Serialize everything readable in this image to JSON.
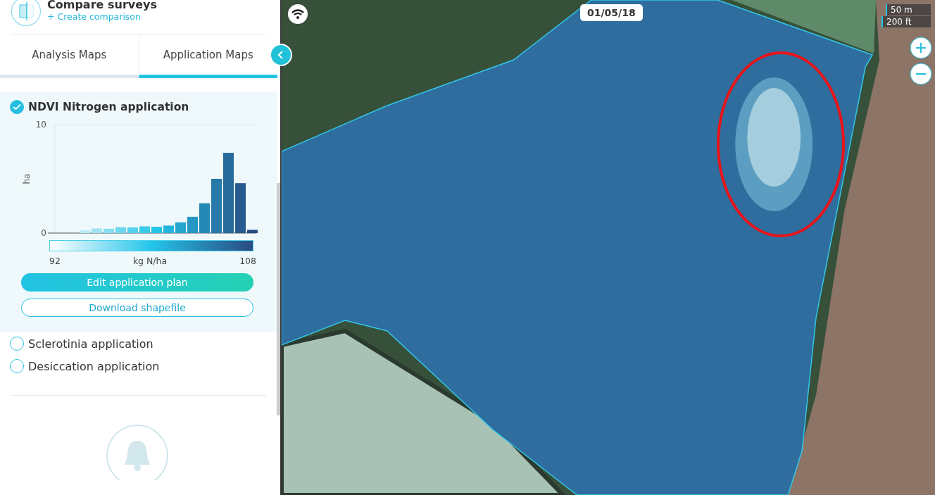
{
  "header": {
    "title": "Compare surveys",
    "link": "+ Create comparison"
  },
  "tabs": [
    {
      "label": "Analysis Maps",
      "selected": false
    },
    {
      "label": "Application Maps",
      "selected": true
    }
  ],
  "layers": [
    {
      "name": "NDVI Nitrogen application",
      "checked": true,
      "details": {
        "chart_data": {
          "type": "bar",
          "ylabel": "ha",
          "yticks": [
            0,
            10
          ],
          "ylim": [
            0,
            10
          ],
          "series": [
            {
              "values": [
                0,
                0,
                0.26,
                0.43,
                0.4,
                0.54,
                0.52,
                0.62,
                0.58,
                0.69,
                0.99,
                1.5,
                2.75,
                5.0,
                7.4,
                4.6,
                0.3
              ]
            }
          ]
        },
        "scale_min": "92",
        "scale_unit": "kg N/ha",
        "scale_max": "108",
        "primary_button": "Edit application plan",
        "secondary_button": "Download shapefile"
      }
    },
    {
      "name": "Sclerotinia application",
      "checked": false
    },
    {
      "name": "Desiccation application",
      "checked": false
    }
  ],
  "map": {
    "date": "01/05/18",
    "scale": [
      "50 m",
      "200 ft"
    ]
  }
}
